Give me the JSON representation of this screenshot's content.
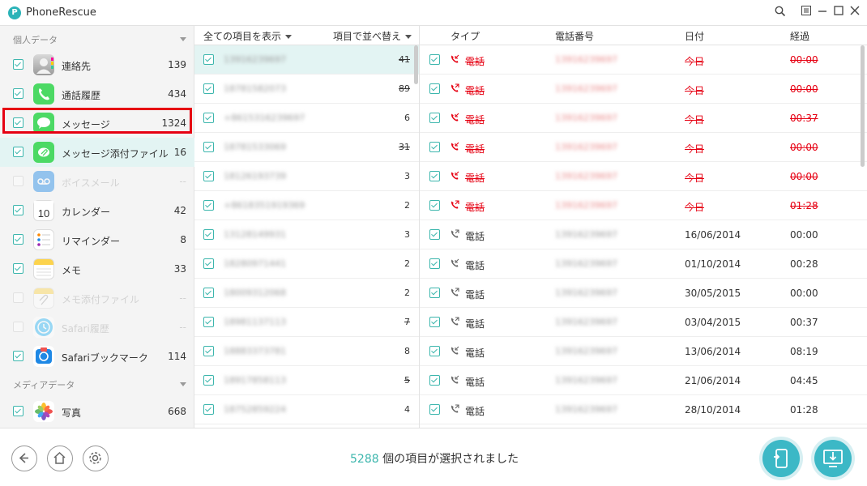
{
  "app": {
    "title": "PhoneRescue",
    "logo": "P"
  },
  "window_controls": [
    "search-icon",
    "menu-icon",
    "minimize-icon",
    "maximize-icon",
    "close-icon"
  ],
  "sidebar": {
    "personal_header": "個人データ",
    "media_header": "メディアデータ",
    "items": [
      {
        "label": "連絡先",
        "count": "139",
        "checked": true,
        "icon": "contacts-icon"
      },
      {
        "label": "通話履歴",
        "count": "434",
        "checked": true,
        "icon": "phone-icon"
      },
      {
        "label": "メッセージ",
        "count": "1324",
        "checked": true,
        "icon": "messages-icon"
      },
      {
        "label": "メッセージ添付ファイル",
        "count": "16",
        "checked": true,
        "icon": "attachment-icon"
      },
      {
        "label": "ボイスメール",
        "count": "--",
        "checked": false,
        "icon": "voicemail-icon"
      },
      {
        "label": "カレンダー",
        "count": "42",
        "checked": true,
        "icon": "calendar-icon",
        "icon_text": "10"
      },
      {
        "label": "リマインダー",
        "count": "8",
        "checked": true,
        "icon": "reminders-icon"
      },
      {
        "label": "メモ",
        "count": "33",
        "checked": true,
        "icon": "notes-icon"
      },
      {
        "label": "メモ添付ファイル",
        "count": "--",
        "checked": false,
        "icon": "notes-attachment-icon"
      },
      {
        "label": "Safari履歴",
        "count": "--",
        "checked": false,
        "icon": "safari-history-icon"
      },
      {
        "label": "Safariブックマーク",
        "count": "114",
        "checked": true,
        "icon": "safari-bookmark-icon"
      }
    ],
    "media_items": [
      {
        "label": "写真",
        "count": "668",
        "checked": true,
        "icon": "photos-icon"
      }
    ]
  },
  "middle": {
    "show_all": "全ての項目を表示",
    "sort_by": "項目で並べ替え",
    "rows": [
      {
        "contact": "13916239697",
        "count": "41",
        "deleted": true
      },
      {
        "contact": "18781582073",
        "count": "89",
        "deleted": true
      },
      {
        "contact": "+8615316239697",
        "count": "6",
        "deleted": false
      },
      {
        "contact": "18781533069",
        "count": "31",
        "deleted": true
      },
      {
        "contact": "18126193739",
        "count": "3",
        "deleted": false
      },
      {
        "contact": "+8618351919369",
        "count": "2",
        "deleted": false
      },
      {
        "contact": "13128149931",
        "count": "3",
        "deleted": false
      },
      {
        "contact": "18280971441",
        "count": "2",
        "deleted": false
      },
      {
        "contact": "18009312068",
        "count": "2",
        "deleted": false
      },
      {
        "contact": "18981137113",
        "count": "7",
        "deleted": true
      },
      {
        "contact": "18883373781",
        "count": "8",
        "deleted": false
      },
      {
        "contact": "18917858113",
        "count": "5",
        "deleted": true
      },
      {
        "contact": "18752859224",
        "count": "4",
        "deleted": false
      }
    ]
  },
  "table": {
    "headers": {
      "type": "タイプ",
      "number": "電話番号",
      "date": "日付",
      "duration": "経過"
    },
    "rows": [
      {
        "type": "電話",
        "number": "13916239697",
        "date": "今日",
        "duration": "00:00",
        "deleted": true,
        "direction": "in"
      },
      {
        "type": "電話",
        "number": "13916239697",
        "date": "今日",
        "duration": "00:00",
        "deleted": true,
        "direction": "out"
      },
      {
        "type": "電話",
        "number": "13916239697",
        "date": "今日",
        "duration": "00:37",
        "deleted": true,
        "direction": "in"
      },
      {
        "type": "電話",
        "number": "13916239697",
        "date": "今日",
        "duration": "00:00",
        "deleted": true,
        "direction": "in"
      },
      {
        "type": "電話",
        "number": "13916239697",
        "date": "今日",
        "duration": "00:00",
        "deleted": true,
        "direction": "in"
      },
      {
        "type": "電話",
        "number": "13916239697",
        "date": "今日",
        "duration": "01:28",
        "deleted": true,
        "direction": "out"
      },
      {
        "type": "電話",
        "number": "13916239697",
        "date": "16/06/2014",
        "duration": "00:00",
        "deleted": false,
        "direction": "out"
      },
      {
        "type": "電話",
        "number": "13916239697",
        "date": "01/10/2014",
        "duration": "00:28",
        "deleted": false,
        "direction": "in"
      },
      {
        "type": "電話",
        "number": "13916239697",
        "date": "30/05/2015",
        "duration": "00:00",
        "deleted": false,
        "direction": "out"
      },
      {
        "type": "電話",
        "number": "13916239697",
        "date": "03/04/2015",
        "duration": "00:37",
        "deleted": false,
        "direction": "out"
      },
      {
        "type": "電話",
        "number": "13916239697",
        "date": "13/06/2014",
        "duration": "08:19",
        "deleted": false,
        "direction": "in"
      },
      {
        "type": "電話",
        "number": "13916239697",
        "date": "21/06/2014",
        "duration": "04:45",
        "deleted": false,
        "direction": "in"
      },
      {
        "type": "電話",
        "number": "13916239697",
        "date": "28/10/2014",
        "duration": "01:28",
        "deleted": false,
        "direction": "out"
      }
    ]
  },
  "footer": {
    "count": "5288",
    "status_text": "個の項目が選択されました",
    "buttons": [
      "back-icon",
      "home-icon",
      "settings-icon"
    ],
    "actions": [
      "recover-to-device-icon",
      "recover-to-computer-icon"
    ]
  },
  "colors": {
    "accent": "#3cb6ad",
    "deleted": "#e60012",
    "highlight": "#e3f4f3"
  }
}
